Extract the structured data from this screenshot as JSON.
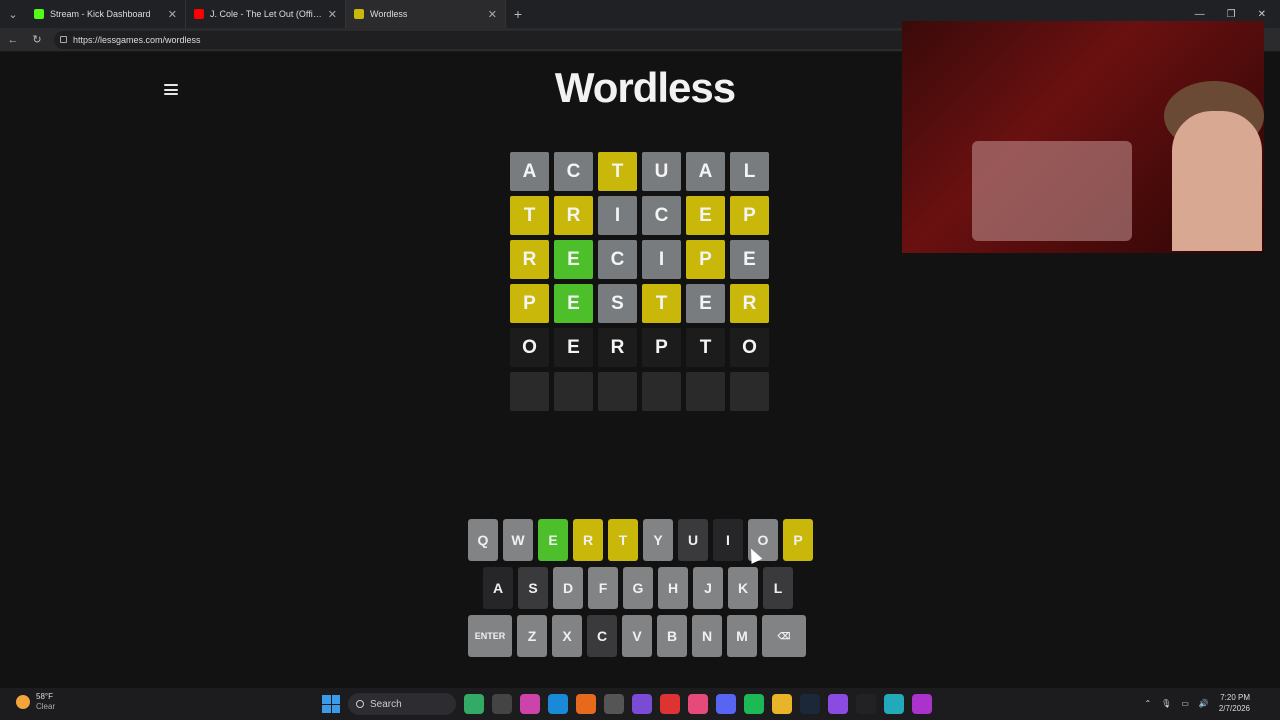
{
  "browser": {
    "tabs": [
      {
        "title": "Stream - Kick Dashboard",
        "favicon_color": "#53fc18"
      },
      {
        "title": "J. Cole - The Let Out (Official...",
        "favicon_color": "#ff0000"
      },
      {
        "title": "Wordless",
        "favicon_color": "#c9b80a"
      }
    ],
    "url": "https://lessgames.com/wordless"
  },
  "game": {
    "title": "Wordless",
    "board": [
      [
        {
          "l": "A",
          "s": "gray"
        },
        {
          "l": "C",
          "s": "gray"
        },
        {
          "l": "T",
          "s": "yellow"
        },
        {
          "l": "U",
          "s": "gray"
        },
        {
          "l": "A",
          "s": "gray"
        },
        {
          "l": "L",
          "s": "gray"
        }
      ],
      [
        {
          "l": "T",
          "s": "yellow"
        },
        {
          "l": "R",
          "s": "yellow"
        },
        {
          "l": "I",
          "s": "gray"
        },
        {
          "l": "C",
          "s": "gray"
        },
        {
          "l": "E",
          "s": "yellow"
        },
        {
          "l": "P",
          "s": "yellow"
        }
      ],
      [
        {
          "l": "R",
          "s": "yellow"
        },
        {
          "l": "E",
          "s": "green"
        },
        {
          "l": "C",
          "s": "gray"
        },
        {
          "l": "I",
          "s": "gray"
        },
        {
          "l": "P",
          "s": "yellow"
        },
        {
          "l": "E",
          "s": "gray"
        }
      ],
      [
        {
          "l": "P",
          "s": "yellow"
        },
        {
          "l": "E",
          "s": "green"
        },
        {
          "l": "S",
          "s": "gray"
        },
        {
          "l": "T",
          "s": "yellow"
        },
        {
          "l": "E",
          "s": "gray"
        },
        {
          "l": "R",
          "s": "yellow"
        }
      ],
      [
        {
          "l": "O",
          "s": "typed"
        },
        {
          "l": "E",
          "s": "typed"
        },
        {
          "l": "R",
          "s": "typed"
        },
        {
          "l": "P",
          "s": "typed"
        },
        {
          "l": "T",
          "s": "typed"
        },
        {
          "l": "O",
          "s": "typed"
        }
      ],
      [
        {
          "l": "",
          "s": "empty"
        },
        {
          "l": "",
          "s": "empty"
        },
        {
          "l": "",
          "s": "empty"
        },
        {
          "l": "",
          "s": "empty"
        },
        {
          "l": "",
          "s": "empty"
        },
        {
          "l": "",
          "s": "empty"
        }
      ]
    ],
    "keyboard": [
      [
        {
          "k": "Q",
          "s": "default"
        },
        {
          "k": "W",
          "s": "default"
        },
        {
          "k": "E",
          "s": "correct"
        },
        {
          "k": "R",
          "s": "present"
        },
        {
          "k": "T",
          "s": "present"
        },
        {
          "k": "Y",
          "s": "default"
        },
        {
          "k": "U",
          "s": "absent"
        },
        {
          "k": "I",
          "s": "dark"
        },
        {
          "k": "O",
          "s": "default"
        },
        {
          "k": "P",
          "s": "present"
        }
      ],
      [
        {
          "k": "A",
          "s": "dark"
        },
        {
          "k": "S",
          "s": "absent"
        },
        {
          "k": "D",
          "s": "default"
        },
        {
          "k": "F",
          "s": "default"
        },
        {
          "k": "G",
          "s": "default"
        },
        {
          "k": "H",
          "s": "default"
        },
        {
          "k": "J",
          "s": "default"
        },
        {
          "k": "K",
          "s": "default"
        },
        {
          "k": "L",
          "s": "absent"
        }
      ],
      [
        {
          "k": "ENTER",
          "s": "default",
          "wide": true
        },
        {
          "k": "Z",
          "s": "default"
        },
        {
          "k": "X",
          "s": "default"
        },
        {
          "k": "C",
          "s": "absent"
        },
        {
          "k": "V",
          "s": "default"
        },
        {
          "k": "B",
          "s": "default"
        },
        {
          "k": "N",
          "s": "default"
        },
        {
          "k": "M",
          "s": "default"
        },
        {
          "k": "⌫",
          "s": "default",
          "wide": true
        }
      ]
    ],
    "colors": {
      "correct": "#4cbf2a",
      "present": "#c9b80a",
      "absent": "#787c7e"
    }
  },
  "taskbar": {
    "weather_temp": "58°F",
    "weather_desc": "Clear",
    "search_label": "Search",
    "time": "7:20 PM",
    "date": "2/7/2026"
  }
}
